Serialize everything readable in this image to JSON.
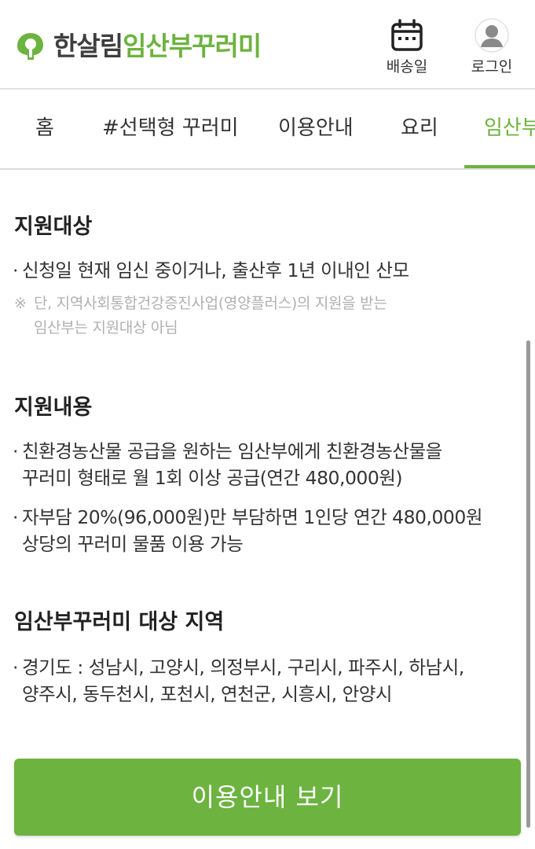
{
  "header": {
    "logo_brand": "한살림",
    "logo_sub": "임산부꾸러미",
    "delivery_label": "배송일",
    "login_label": "로그인"
  },
  "nav": {
    "items": [
      "홈",
      "#선택형 꾸러미",
      "이용안내",
      "요리",
      "임산부"
    ],
    "active_index": 4
  },
  "sections": {
    "target": {
      "title": "지원대상",
      "bullet": "신청일 현재 임신 중이거나, 출산후 1년 이내인 산모",
      "note_mark": "※",
      "note_line1": "단, 지역사회통합건강증진사업(영양플러스)의 지원을 받는",
      "note_line2": "임산부는 지원대상 아님"
    },
    "content": {
      "title": "지원내용",
      "bullet1_line1": "친환경농산물 공급을 원하는 임산부에게 친환경농산물을",
      "bullet1_line2": "꾸러미 형태로 월 1회 이상 공급(연간 480,000원)",
      "bullet2_line1": "자부담 20%(96,000원)만 부담하면 1인당 연간 480,000원",
      "bullet2_line2": "상당의 꾸러미 물품 이용 가능"
    },
    "region": {
      "title": "임산부꾸러미 대상 지역",
      "bullet_line1": "경기도 : 성남시, 고양시, 의정부시, 구리시, 파주시, 하남시,",
      "bullet_line2": "양주시, 동두천시, 포천시, 연천군, 시흥시, 안양시"
    }
  },
  "bullet_dot": "·",
  "cta_label": "이용안내 보기",
  "colors": {
    "brand_green": "#6db33f",
    "logo_dark": "#3e3e3e",
    "note_gray": "#b0b0b0"
  }
}
